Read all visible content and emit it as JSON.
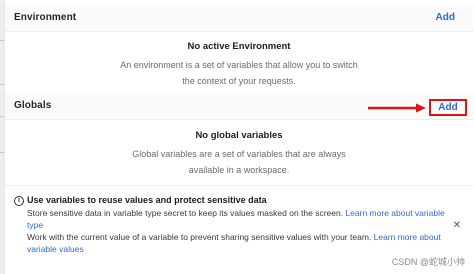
{
  "environment": {
    "title": "Environment",
    "add_label": "Add",
    "empty_title": "No active Environment",
    "empty_description": "An environment is a set of variables that allow you to switch the context of your requests."
  },
  "globals": {
    "title": "Globals",
    "add_label": "Add",
    "empty_title": "No global variables",
    "empty_description": "Global variables are a set of variables that are always available in a workspace."
  },
  "notice": {
    "title": "Use variables to reuse values and protect sensitive data",
    "line1_text": "Store sensitive data in variable type secret to keep its values masked on the screen. ",
    "line1_link": "Learn more about variable type",
    "line2_text": "Work with the current value of a variable to prevent sharing sensitive values with your team. ",
    "line2_link": "Learn more about variable values",
    "close_glyph": "✕",
    "info_glyph": "i"
  },
  "watermark": "CSDN @蛇城小帅",
  "annotation": {
    "highlight_color": "#e01414",
    "arrow_color": "#e01414"
  },
  "colors": {
    "accent": "#2f6bd6"
  }
}
